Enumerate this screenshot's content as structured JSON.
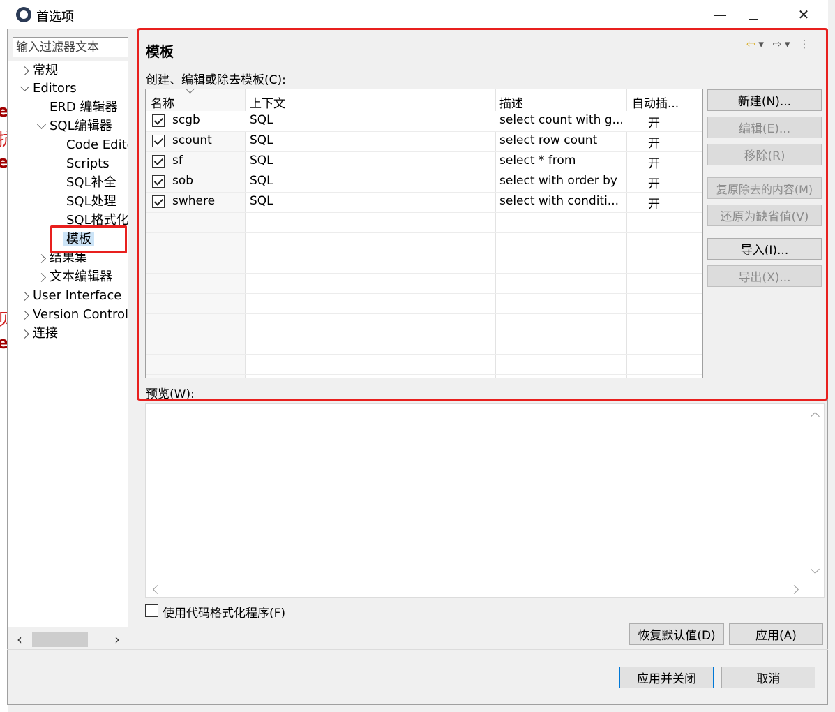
{
  "window": {
    "title": "首选项",
    "minimize": "—",
    "close": "✕"
  },
  "filter": {
    "placeholder": "输入过滤器文本"
  },
  "tree": {
    "items": [
      {
        "label": "常规",
        "expand": "collapsed"
      },
      {
        "label": "Editors",
        "expand": "expanded"
      },
      {
        "label": "ERD 编辑器",
        "expand": "none"
      },
      {
        "label": "SQL编辑器",
        "expand": "expanded"
      },
      {
        "label": "Code Editor",
        "expand": "none"
      },
      {
        "label": "Scripts",
        "expand": "none"
      },
      {
        "label": "SQL补全",
        "expand": "none"
      },
      {
        "label": "SQL处理",
        "expand": "none"
      },
      {
        "label": "SQL格式化",
        "expand": "none"
      },
      {
        "label": "模板",
        "expand": "none",
        "selected": true
      },
      {
        "label": "结果集",
        "expand": "collapsed"
      },
      {
        "label": "文本编辑器",
        "expand": "collapsed"
      },
      {
        "label": "User Interface",
        "expand": "collapsed"
      },
      {
        "label": "Version Control",
        "expand": "collapsed"
      },
      {
        "label": "连接",
        "expand": "collapsed"
      }
    ],
    "scroll_left": "‹",
    "scroll_right": "›"
  },
  "page": {
    "title": "模板",
    "table_label": "创建、编辑或除去模板(C):",
    "preview_label": "预览(W):",
    "formatter_label": "使用代码格式化程序(F)"
  },
  "table": {
    "columns": [
      "名称",
      "上下文",
      "描述",
      "自动插..."
    ],
    "rows": [
      {
        "name": "scgb",
        "context": "SQL",
        "desc": "select count with g...",
        "auto": "开",
        "checked": true
      },
      {
        "name": "scount",
        "context": "SQL",
        "desc": "select row count",
        "auto": "开",
        "checked": true
      },
      {
        "name": "sf",
        "context": "SQL",
        "desc": "select * from",
        "auto": "开",
        "checked": true
      },
      {
        "name": "sob",
        "context": "SQL",
        "desc": "select with order by",
        "auto": "开",
        "checked": true
      },
      {
        "name": "swhere",
        "context": "SQL",
        "desc": "select with conditi...",
        "auto": "开",
        "checked": true
      }
    ]
  },
  "side_buttons": {
    "new": "新建(N)...",
    "edit": "编辑(E)...",
    "remove": "移除(R)",
    "restore_removed": "复原除去的内容(M)",
    "revert_default": "还原为缺省值(V)",
    "import": "导入(I)...",
    "export": "导出(X)..."
  },
  "bottom_buttons": {
    "restore_defaults": "恢复默认值(D)",
    "apply": "应用(A)",
    "apply_close": "应用并关闭",
    "cancel": "取消"
  },
  "nav": {
    "back": "⇦",
    "forward": "⇨",
    "dropdown": "▾",
    "menu": "⋮"
  },
  "background_fragments": [
    "e",
    "抗",
    "e",
    "贝",
    "e"
  ],
  "colors": {
    "highlight": "#e8201e",
    "selection": "#cce4f7",
    "primary_border": "#0078d7"
  }
}
